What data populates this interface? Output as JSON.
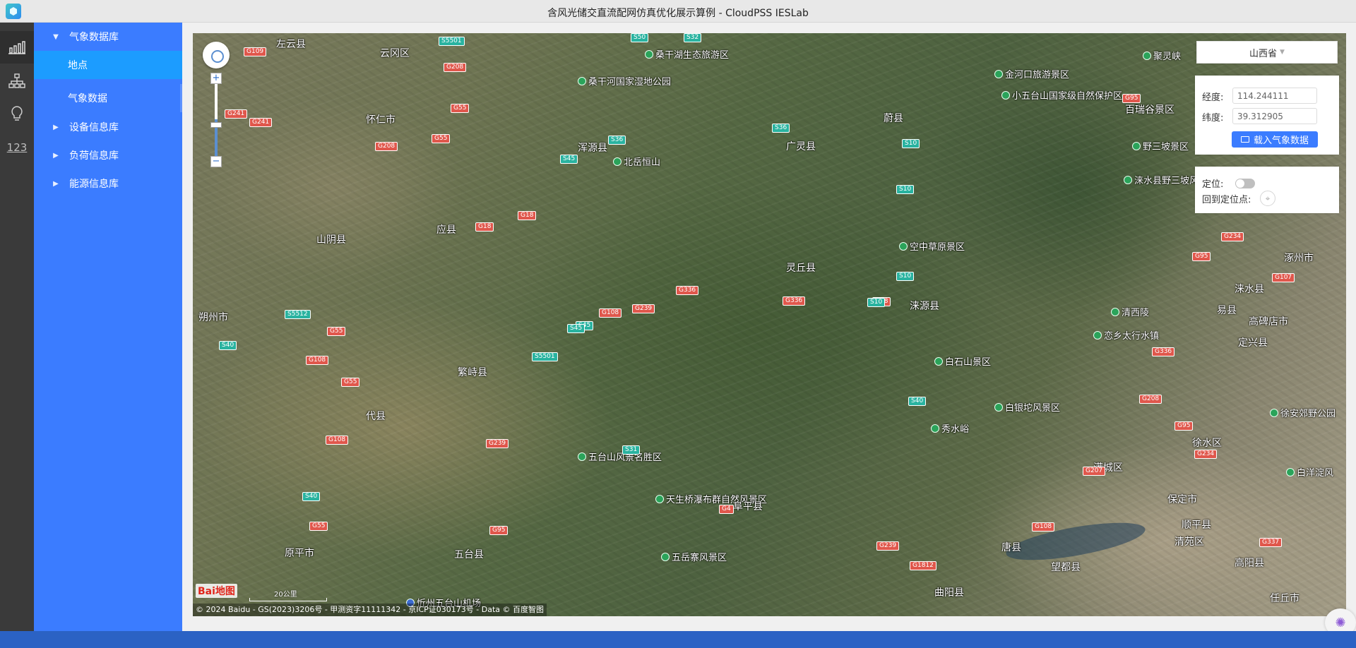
{
  "window": {
    "title": "含风光储交直流配网仿真优化展示算例 - CloudPSS IESLab"
  },
  "rail": {
    "items": [
      {
        "name": "chart-icon"
      },
      {
        "name": "network-icon"
      },
      {
        "name": "bulb-icon"
      },
      {
        "label": "123"
      }
    ]
  },
  "sidebar": {
    "items": [
      {
        "label": "气象数据库",
        "expanded": true
      },
      {
        "label": "地点",
        "selected": true
      },
      {
        "label": "气象数据"
      },
      {
        "label": "设备信息库",
        "expanded": false
      },
      {
        "label": "负荷信息库",
        "expanded": false
      },
      {
        "label": "能源信息库",
        "expanded": false
      }
    ]
  },
  "map": {
    "zoom": {
      "plus": "+",
      "minus": "−"
    },
    "logo": "Bai地图",
    "scale": "20公里",
    "copyright": "© 2024 Baidu - GS(2023)3206号 - 甲测资字11111342 - 京ICP证030173号 - Data © 百度智图",
    "places": [
      {
        "text": "左云县",
        "kind": "city"
      },
      {
        "text": "云冈区",
        "kind": "city"
      },
      {
        "text": "桑干河国家湿地公园",
        "kind": "scenic"
      },
      {
        "text": "桑干湖生态旅游区",
        "kind": "scenic"
      },
      {
        "text": "怀仁市",
        "kind": "city"
      },
      {
        "text": "浑源县",
        "kind": "city"
      },
      {
        "text": "北岳恒山",
        "kind": "scenic"
      },
      {
        "text": "广灵县",
        "kind": "city"
      },
      {
        "text": "蔚县",
        "kind": "city"
      },
      {
        "text": "金河口旅游景区",
        "kind": "scenic"
      },
      {
        "text": "小五台山国家级自然保护区",
        "kind": "scenic"
      },
      {
        "text": "聚灵峡",
        "kind": "scenic"
      },
      {
        "text": "百瑞谷景区",
        "kind": "city"
      },
      {
        "text": "野三坡景区",
        "kind": "scenic"
      },
      {
        "text": "涞水县野三坡风景区",
        "kind": "scenic"
      },
      {
        "text": "山阴县",
        "kind": "city"
      },
      {
        "text": "应县",
        "kind": "city"
      },
      {
        "text": "空中草原景区",
        "kind": "scenic"
      },
      {
        "text": "灵丘县",
        "kind": "city"
      },
      {
        "text": "涿州市",
        "kind": "city"
      },
      {
        "text": "涞水县",
        "kind": "city"
      },
      {
        "text": "朔州市",
        "kind": "city"
      },
      {
        "text": "涞源县",
        "kind": "city"
      },
      {
        "text": "清西陵",
        "kind": "scenic"
      },
      {
        "text": "易县",
        "kind": "city"
      },
      {
        "text": "恋乡太行水镇",
        "kind": "scenic"
      },
      {
        "text": "高碑店市",
        "kind": "city"
      },
      {
        "text": "定兴县",
        "kind": "city"
      },
      {
        "text": "繁峙县",
        "kind": "city"
      },
      {
        "text": "白石山景区",
        "kind": "scenic"
      },
      {
        "text": "代县",
        "kind": "city"
      },
      {
        "text": "白银坨风景区",
        "kind": "scenic"
      },
      {
        "text": "秀水峪",
        "kind": "scenic"
      },
      {
        "text": "徐安郊野公园",
        "kind": "scenic"
      },
      {
        "text": "五台山风景名胜区",
        "kind": "scenic"
      },
      {
        "text": "徐水区",
        "kind": "city"
      },
      {
        "text": "满城区",
        "kind": "city"
      },
      {
        "text": "白洋淀风",
        "kind": "scenic"
      },
      {
        "text": "天生桥瀑布群自然风景区",
        "kind": "scenic"
      },
      {
        "text": "阜平县",
        "kind": "city"
      },
      {
        "text": "保定市",
        "kind": "city"
      },
      {
        "text": "顺平县",
        "kind": "city"
      },
      {
        "text": "原平市",
        "kind": "city"
      },
      {
        "text": "五台县",
        "kind": "city"
      },
      {
        "text": "五岳寨风景区",
        "kind": "scenic"
      },
      {
        "text": "唐县",
        "kind": "city"
      },
      {
        "text": "清苑区",
        "kind": "city"
      },
      {
        "text": "望都县",
        "kind": "city"
      },
      {
        "text": "高阳县",
        "kind": "city"
      },
      {
        "text": "曲阳县",
        "kind": "city"
      },
      {
        "text": "任丘市",
        "kind": "city"
      },
      {
        "text": "忻州五台山机场",
        "kind": "airport"
      }
    ],
    "shields": [
      "G109",
      "S5501",
      "G208",
      "S50",
      "S32",
      "G55",
      "G241",
      "G241",
      "G55",
      "S36",
      "G208",
      "S36",
      "S45",
      "G95",
      "G234",
      "G95",
      "G107",
      "S10",
      "S10",
      "G18",
      "G18",
      "S10",
      "G336",
      "G18",
      "G336",
      "S10",
      "S45",
      "G239",
      "S5512",
      "G55",
      "S45",
      "G108",
      "S40",
      "S5501",
      "G108",
      "G55",
      "S40",
      "G208",
      "G336",
      "G108",
      "S31",
      "G95",
      "G234",
      "S40",
      "G239",
      "G95",
      "G4",
      "G55",
      "G239",
      "G1812",
      "G207",
      "G108",
      "G337",
      "S31",
      "G107",
      "G234",
      "S5"
    ]
  },
  "controls": {
    "province": "山西省",
    "longitude_label": "经度:",
    "longitude_value": "114.244111",
    "latitude_label": "纬度:",
    "latitude_value": "39.312905",
    "load_button": "载入气象数据",
    "locate_label": "定位:",
    "locate_enabled": false,
    "back_label": "回到定位点:"
  },
  "colors": {
    "sidebar": "#3b7cff",
    "sidebar_selected": "#1c9cff",
    "rail": "#3a3a3a",
    "statusbar": "#2b62c4",
    "highway_shield": "#e0574c",
    "provincial_shield": "#29b3a0"
  }
}
